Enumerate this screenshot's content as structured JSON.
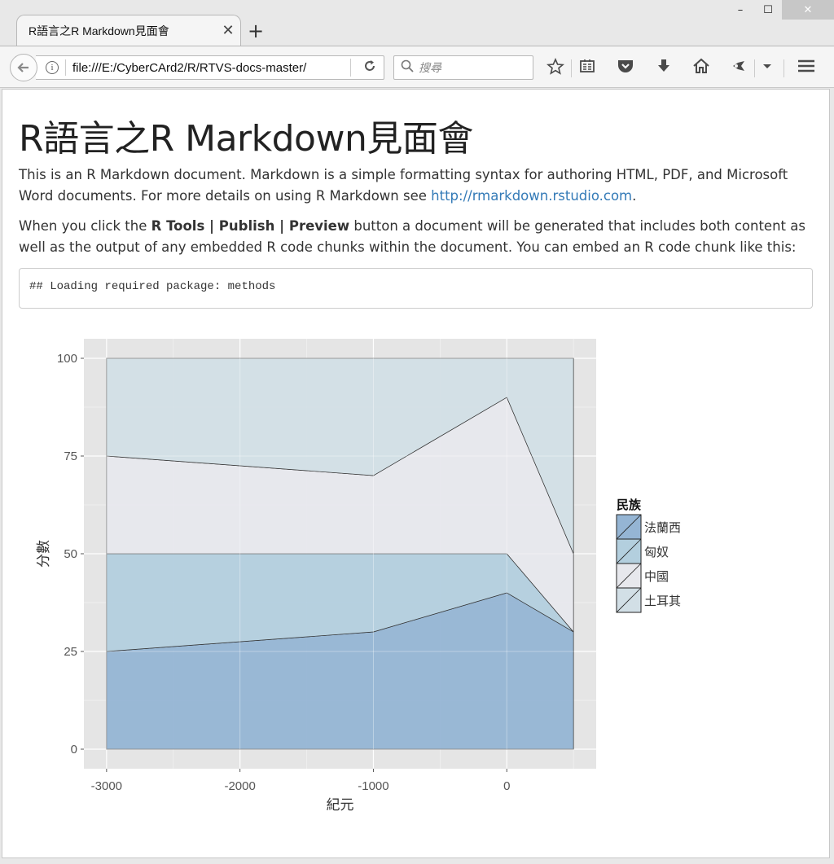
{
  "window": {
    "minimize": "–",
    "maximize": "☐",
    "close": "✕"
  },
  "tab": {
    "title": "R語言之R Markdown見面會",
    "close_icon": "✕",
    "new_tab": "+"
  },
  "nav": {
    "url": "file:///E:/CyberCArd2/R/RTVS-docs-master/",
    "search_placeholder": "搜尋",
    "icons": [
      "back-icon",
      "info-icon",
      "reload-icon",
      "search-icon",
      "bookmark-star-icon",
      "reading-list-icon",
      "pocket-icon",
      "download-icon",
      "home-icon",
      "extension-icon",
      "dropdown-icon",
      "menu-icon"
    ]
  },
  "doc": {
    "title": "R語言之R Markdown見面會",
    "p1_before": "This is an R Markdown document. Markdown is a simple formatting syntax for authoring HTML, PDF, and Microsoft Word documents. For more details on using R Markdown see ",
    "p1_link": "http://rmarkdown.rstudio.com",
    "p1_after": ".",
    "p2_before": "When you click the ",
    "p2_bold": "R Tools | Publish | Preview",
    "p2_after": " button a document will be generated that includes both content as well as the output of any embedded R code chunks within the document. You can embed an R code chunk like this:",
    "code_output": "## Loading required package: methods"
  },
  "chart_data": {
    "type": "area",
    "stacked": true,
    "x": [
      -3000,
      -1000,
      0,
      500
    ],
    "series": [
      {
        "name": "法蘭西",
        "values": [
          25,
          30,
          40,
          30
        ],
        "color": "#95b5d4"
      },
      {
        "name": "匈奴",
        "values": [
          25,
          20,
          10,
          0
        ],
        "color": "#b3cfde"
      },
      {
        "name": "中國",
        "values": [
          25,
          20,
          40,
          20
        ],
        "color": "#e7e8ed"
      },
      {
        "name": "土耳其",
        "values": [
          25,
          30,
          10,
          50
        ],
        "color": "#d2dfe6"
      }
    ],
    "xlabel": "紀元",
    "ylabel": "分數",
    "legend_title": "民族",
    "legend_position": "right",
    "xticks": [
      -3000,
      -2000,
      -1000,
      0
    ],
    "yticks": [
      0,
      25,
      50,
      75,
      100
    ],
    "xlim": [
      -3170,
      670
    ],
    "ylim": [
      -5,
      105
    ],
    "grid": true,
    "background": "#e5e5e5"
  }
}
